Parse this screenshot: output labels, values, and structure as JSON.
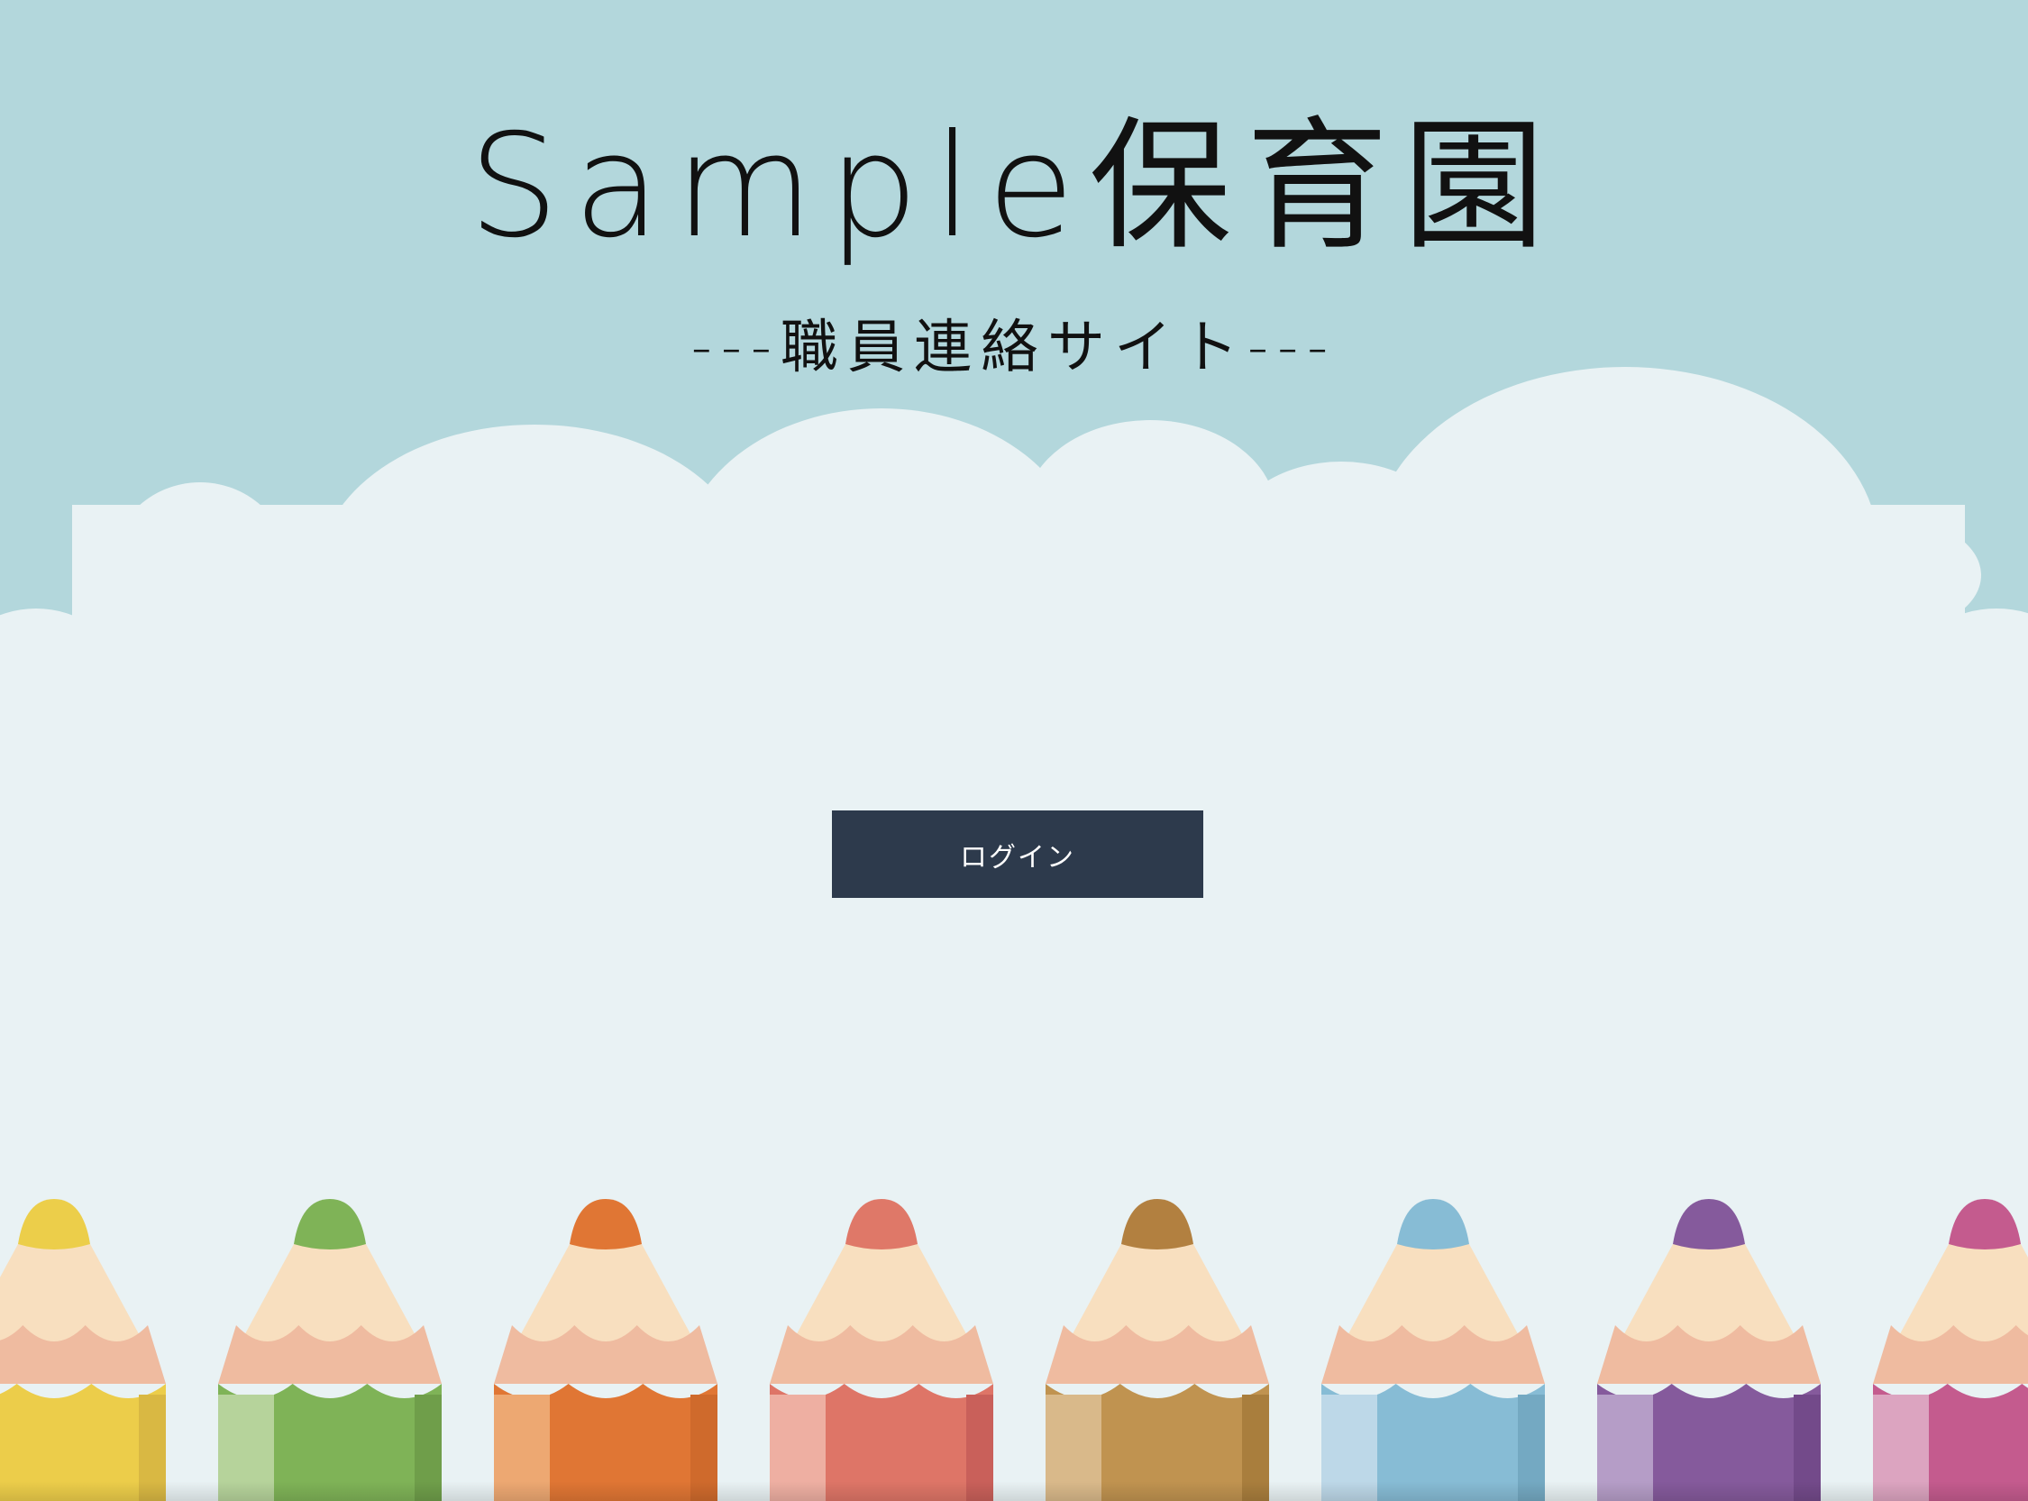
{
  "header": {
    "title": "Sample保育園",
    "subtitle": "---職員連絡サイト---"
  },
  "actions": {
    "login_label": "ログイン"
  },
  "colors": {
    "sky": "#b3d7dc",
    "cloud": "#e9f2f4",
    "button": "#2d3a4c",
    "button_text": "#ffffff",
    "text": "#111111"
  },
  "pencils": [
    {
      "name": "yellow",
      "light": "#f9e04f",
      "mid": "#eccd4a",
      "dark": "#d9b843",
      "tip": "#ecce4a"
    },
    {
      "name": "green",
      "light": "#b6d39b",
      "mid": "#7fb357",
      "dark": "#6f9e4a",
      "tip": "#7fb357"
    },
    {
      "name": "orange",
      "light": "#eda872",
      "mid": "#e07634",
      "dark": "#cf6a2c",
      "tip": "#e07634"
    },
    {
      "name": "red",
      "light": "#eeafa2",
      "mid": "#de7567",
      "dark": "#c9605a",
      "tip": "#df7868"
    },
    {
      "name": "brown",
      "light": "#d9b98a",
      "mid": "#c09350",
      "dark": "#a97e3d",
      "tip": "#b28040"
    },
    {
      "name": "blue",
      "light": "#bdd8e8",
      "mid": "#87bcd5",
      "dark": "#74a9c2",
      "tip": "#87bcd5"
    },
    {
      "name": "purple",
      "light": "#b59dc7",
      "mid": "#855a9c",
      "dark": "#734a8a",
      "tip": "#855a9c"
    },
    {
      "name": "pink",
      "light": "#dca4c0",
      "mid": "#c45b8e",
      "dark": "#ad4c7c",
      "tip": "#c45b8e"
    }
  ]
}
